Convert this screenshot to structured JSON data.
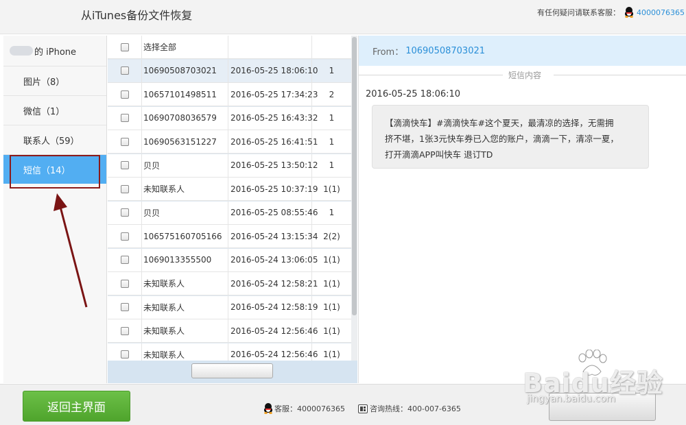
{
  "header": {
    "title": "从iTunes备份文件恢复",
    "support_label": "有任何疑问请联系客服：",
    "support_phone": "4000076365"
  },
  "sidebar": {
    "device_suffix": "的 iPhone",
    "items": [
      {
        "label": "图片（8）"
      },
      {
        "label": "微信（1）"
      },
      {
        "label": "联系人（59）"
      },
      {
        "label": "短信（14）"
      }
    ],
    "active_index": 3
  },
  "list": {
    "select_all_label": "选择全部",
    "rows": [
      {
        "name": "10690508703021",
        "time": "2016-05-25 18:06:10",
        "count": "1"
      },
      {
        "name": "10657101498511",
        "time": "2016-05-25 17:34:23",
        "count": "2"
      },
      {
        "name": "10690708036579",
        "time": "2016-05-25 16:43:32",
        "count": "1"
      },
      {
        "name": "10690563151227",
        "time": "2016-05-25 16:41:51",
        "count": "1"
      },
      {
        "name": "贝贝",
        "time": "2016-05-25 13:50:12",
        "count": "1"
      },
      {
        "name": "未知联系人",
        "time": "2016-05-25 10:37:19",
        "count": "1(1)"
      },
      {
        "name": "贝贝",
        "time": "2016-05-25 08:55:46",
        "count": "1"
      },
      {
        "name": "106575160705166",
        "time": "2016-05-24 13:15:34",
        "count": "2(2)"
      },
      {
        "name": "1069013355500",
        "time": "2016-05-24 13:06:05",
        "count": "1(1)"
      },
      {
        "name": "未知联系人",
        "time": "2016-05-24 12:58:21",
        "count": "1(1)"
      },
      {
        "name": "未知联系人",
        "time": "2016-05-24 12:58:19",
        "count": "1(1)"
      },
      {
        "name": "未知联系人",
        "time": "2016-05-24 12:56:46",
        "count": "1(1)"
      },
      {
        "name": "未知联系人",
        "time": "2016-05-24 12:56:46",
        "count": "1(1)"
      }
    ],
    "selected_index": 0
  },
  "detail": {
    "from_label": "From：",
    "from_number": "10690508703021",
    "section_label": "短信内容",
    "message_time": "2016-05-25 18:06:10",
    "message_lines": [
      "【滴滴快车】#滴滴快车#这个夏天，最清凉的选择，无需拥",
      "挤不堪，1张3元快车券已入您的账户，滴滴一下，清凉一夏，",
      "打开滴滴APP叫快车 退订TD"
    ]
  },
  "footer": {
    "home_label": "返回主界面",
    "qq_label": "客服：4000076365",
    "hotline_label": "咨询热线：400-007-6365"
  },
  "watermark": {
    "main": "Baidu经验",
    "sub": "jingyan.baidu.com"
  },
  "colors": {
    "accent_blue": "#52aef2",
    "link_blue": "#2a8fd8",
    "home_green": "#5cb23a",
    "highlight_border": "#8b1a1a"
  }
}
